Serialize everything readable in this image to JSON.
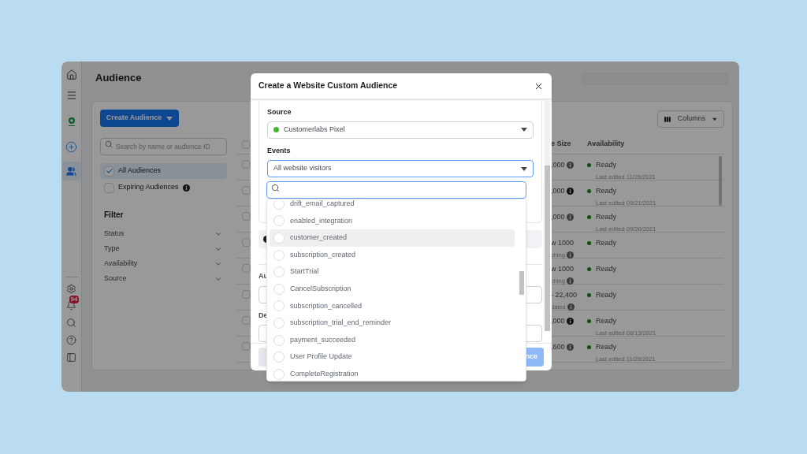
{
  "nav_rail": {
    "notification_badge": "94"
  },
  "header": {
    "title": "Audience"
  },
  "left_panel": {
    "create_button": "Create Audience",
    "search": {
      "placeholder": "Search by name or audience ID"
    },
    "lists": [
      {
        "label": "All Audiences",
        "checked": true,
        "selected": true,
        "info": false
      },
      {
        "label": "Expiring Audiences",
        "checked": false,
        "selected": false,
        "info": true
      }
    ],
    "filter": {
      "title": "Filter",
      "items": [
        "Status",
        "Type",
        "Availability",
        "Source"
      ]
    }
  },
  "table": {
    "columns_button": "Columns",
    "columns": [
      "e Size",
      "Availability"
    ],
    "header_checked": false,
    "rows": [
      {
        "checked": false,
        "size": ",000",
        "status": "Ready",
        "edited": "Last edited 11/25/2021"
      },
      {
        "checked": false,
        "size": ",000",
        "status": "Ready",
        "edited": "Last edited 09/21/2021"
      },
      {
        "checked": false,
        "size": ",000",
        "status": "Ready",
        "edited": "Last edited 09/20/2021"
      },
      {
        "checked": false,
        "size": "w 1000",
        "note": "ching",
        "status": "Ready"
      },
      {
        "checked": false,
        "size": "w 1000",
        "note": "ching",
        "status": "Ready"
      },
      {
        "checked": false,
        "size": "- 22,400",
        "note": "dated",
        "status": "Ready"
      },
      {
        "checked": false,
        "size": ",000",
        "status": "Ready",
        "edited": "Last edited 08/13/2021"
      },
      {
        "checked": false,
        "size": ",600",
        "status": "Ready",
        "edited": "Last edited 11/29/2021"
      }
    ]
  },
  "modal": {
    "title": "Create a Website Custom Audience",
    "source": {
      "label": "Source",
      "value": "Customerlabs Pixel"
    },
    "events": {
      "label": "Events",
      "value": "All website visitors"
    },
    "hidden_labels": [
      "Au",
      "De"
    ],
    "primary_button": "nce",
    "dropdown": {
      "items": [
        {
          "label": "drift_email_captured",
          "checked": false,
          "highlighted": false
        },
        {
          "label": "enabled_integration",
          "checked": false,
          "highlighted": false
        },
        {
          "label": "customer_created",
          "checked": false,
          "highlighted": true
        },
        {
          "label": "subscription_created",
          "checked": false,
          "highlighted": false
        },
        {
          "label": "StartTrial",
          "checked": false,
          "highlighted": false
        },
        {
          "label": "CancelSubscription",
          "checked": false,
          "highlighted": false
        },
        {
          "label": "subscription_cancelled",
          "checked": false,
          "highlighted": false
        },
        {
          "label": "subscription_trial_end_reminder",
          "checked": false,
          "highlighted": false
        },
        {
          "label": "payment_succeeded",
          "checked": false,
          "highlighted": false
        },
        {
          "label": "User Profile Update",
          "checked": false,
          "highlighted": false
        },
        {
          "label": "CompleteRegistration",
          "checked": false,
          "highlighted": false
        }
      ]
    }
  }
}
